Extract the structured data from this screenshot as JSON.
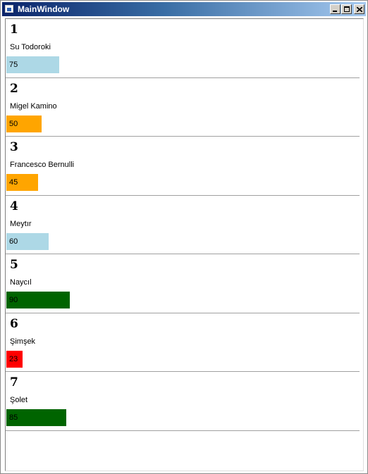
{
  "window": {
    "title": "MainWindow"
  },
  "list": {
    "max_value": 100,
    "items": [
      {
        "rank": "1",
        "name": "Su Todoroki",
        "value": 75,
        "value_label": "75",
        "color": "#add8e6"
      },
      {
        "rank": "2",
        "name": "Migel Kamino",
        "value": 50,
        "value_label": "50",
        "color": "#ffa500"
      },
      {
        "rank": "3",
        "name": "Francesco Bernulli",
        "value": 45,
        "value_label": "45",
        "color": "#ffa500"
      },
      {
        "rank": "4",
        "name": "Meytır",
        "value": 60,
        "value_label": "60",
        "color": "#add8e6"
      },
      {
        "rank": "5",
        "name": "Naycıl",
        "value": 90,
        "value_label": "90",
        "color": "#006400"
      },
      {
        "rank": "6",
        "name": "Şimşek",
        "value": 23,
        "value_label": "23",
        "color": "#ff0000"
      },
      {
        "rank": "7",
        "name": "Şolet",
        "value": 85,
        "value_label": "85",
        "color": "#006400"
      }
    ]
  }
}
